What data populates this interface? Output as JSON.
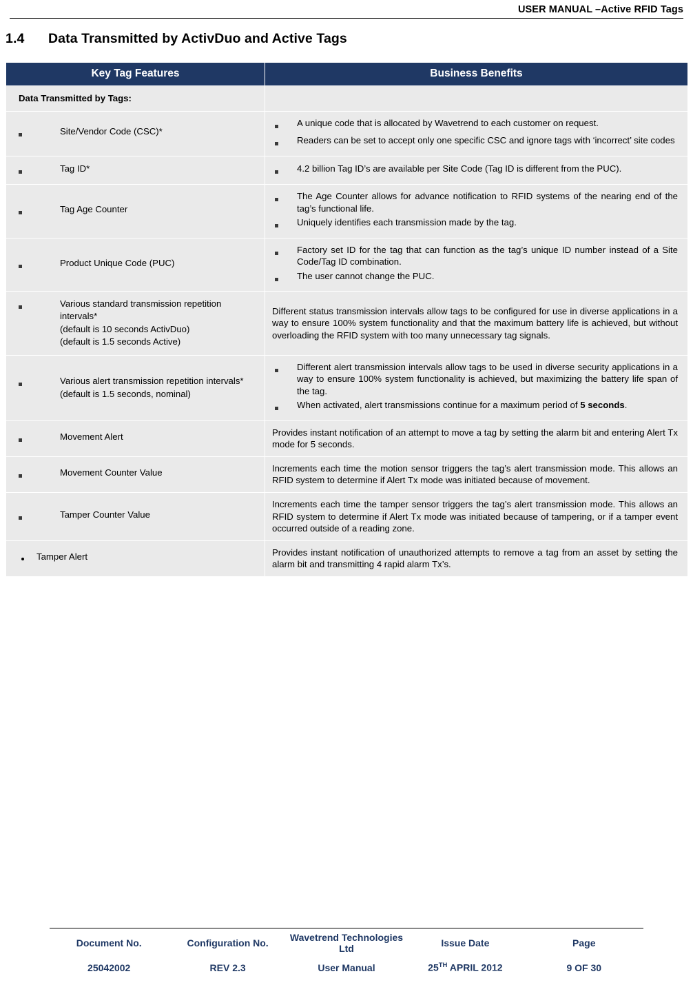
{
  "header": {
    "title": "USER MANUAL –Active RFID Tags"
  },
  "section": {
    "number": "1.4",
    "title": "Data Transmitted by ActivDuo and Active Tags"
  },
  "table": {
    "columns": [
      "Key Tag Features",
      "Business Benefits"
    ],
    "rows": [
      {
        "left_heading": "Data Transmitted by Tags:",
        "left_lines": [],
        "right_bullets": [],
        "right_paragraphs": []
      },
      {
        "left_heading": "",
        "left_lines": [
          "Site/Vendor Code (CSC)*"
        ],
        "right_bullets": [
          "A unique code that is allocated by Wavetrend to each customer on request.",
          "Readers can be set to accept only one specific CSC and ignore tags with ‘incorrect’ site codes"
        ],
        "right_paragraphs": []
      },
      {
        "left_heading": "",
        "left_lines": [
          "Tag ID*"
        ],
        "right_bullets": [
          "4.2 billion Tag ID’s are available per Site Code (Tag ID is different from the PUC)."
        ],
        "right_paragraphs": []
      },
      {
        "left_heading": "",
        "left_lines": [
          "Tag Age Counter"
        ],
        "right_bullets": [
          "The Age Counter allows for advance notification to RFID systems of the nearing end of the tag’s functional life.",
          "Uniquely identifies each transmission made by the tag."
        ],
        "right_paragraphs": []
      },
      {
        "left_heading": "",
        "left_lines": [
          "Product Unique Code (PUC)"
        ],
        "right_bullets": [
          "Factory set ID for the tag that can function as the tag’s unique ID number instead of a Site Code/Tag ID combination.",
          "The user cannot change the PUC."
        ],
        "right_paragraphs": []
      },
      {
        "left_heading": "",
        "left_lines": [
          "Various standard transmission repetition intervals*",
          "(default is 10 seconds ActivDuo)",
          "(default is 1.5 seconds Active)"
        ],
        "right_bullets": [],
        "right_paragraphs": [
          "Different status transmission intervals allow tags to be configured for use in diverse applications in a way to ensure 100% system functionality and that the maximum battery life is achieved, but without overloading the RFID system with too many unnecessary tag signals."
        ]
      },
      {
        "left_heading": "",
        "left_lines": [
          "Various alert transmission repetition intervals*",
          "(default is 1.5 seconds, nominal)"
        ],
        "right_bullets": [
          "Different alert transmission intervals allow tags to be used in diverse security applications in a way to ensure 100% system functionality is achieved, but maximizing the battery life span of the tag."
        ],
        "right_bullets_rich": [
          {
            "pre": "When activated, alert transmissions continue for a maximum period of ",
            "bold": "5 seconds",
            "post": "."
          }
        ],
        "right_paragraphs": []
      },
      {
        "left_heading": "",
        "left_lines": [
          "Movement Alert"
        ],
        "right_bullets": [],
        "right_paragraphs": [
          "Provides instant notification of an attempt to move a tag by setting the alarm bit and entering Alert Tx mode for 5 seconds."
        ]
      },
      {
        "left_heading": "",
        "left_lines": [
          "Movement Counter Value"
        ],
        "right_bullets": [],
        "right_paragraphs": [
          "Increments each time the motion sensor triggers the tag’s alert transmission mode. This allows an RFID system to determine if Alert Tx mode was initiated because of movement."
        ]
      },
      {
        "left_heading": "",
        "left_lines": [
          "Tamper Counter Value"
        ],
        "right_bullets": [],
        "right_paragraphs": [
          "Increments each time the tamper sensor triggers the tag’s alert transmission mode. This allows an RFID system to determine if Alert Tx mode was initiated because of tampering, or if a tamper event occurred outside of a reading zone."
        ]
      },
      {
        "left_heading": "",
        "left_lines": [
          "Tamper Alert"
        ],
        "left_bullet_style": "dot",
        "right_bullets": [],
        "right_paragraphs": [
          "Provides instant notification of unauthorized attempts to remove a tag from an asset by setting the alarm bit and transmitting 4 rapid alarm Tx’s."
        ]
      }
    ]
  },
  "footer": {
    "labels": [
      "Document No.",
      "Configuration No.",
      "Wavetrend Technologies Ltd",
      "Issue Date",
      "Page"
    ],
    "values": [
      "25042002",
      "REV 2.3",
      "User Manual",
      "25TH APRIL 2012",
      "9 OF 30"
    ],
    "issue_date": {
      "day": "25",
      "suffix": "TH",
      "rest": " APRIL 2012"
    }
  },
  "colors": {
    "header_band": "#1f3864",
    "row_bg": "#eaeaea",
    "footer_text": "#1f3864"
  }
}
